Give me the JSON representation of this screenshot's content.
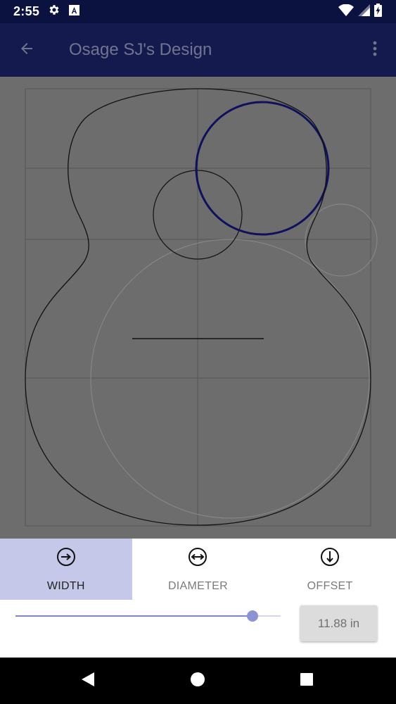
{
  "status_bar": {
    "time": "2:55",
    "icons_left": [
      "gear-icon",
      "a-box-icon"
    ],
    "icons_right": [
      "wifi-icon",
      "signal-icon",
      "battery-charging-icon"
    ]
  },
  "app_bar": {
    "title": "Osage SJ's Design",
    "back_icon": "arrow-left-icon",
    "menu_icon": "more-vert-icon"
  },
  "tabs": [
    {
      "label": "WIDTH",
      "icon": "circle-arrow-right-icon",
      "selected": true
    },
    {
      "label": "DIAMETER",
      "icon": "circle-arrows-horizontal-icon",
      "selected": false
    },
    {
      "label": "OFFSET",
      "icon": "circle-arrow-down-icon",
      "selected": false
    }
  ],
  "slider": {
    "value_fraction": 0.895
  },
  "value_display": "11.88 in",
  "colors": {
    "status_bar": "#0c1240",
    "app_bar": "#141a4e",
    "canvas": "#6d6d6d",
    "selected_tab": "#c5c8e8",
    "accent": "#8c93d2",
    "highlight_circle": "#0f115c"
  },
  "nav_bar": {
    "buttons": [
      "back-triangle-icon",
      "home-circle-icon",
      "recents-square-icon"
    ]
  }
}
